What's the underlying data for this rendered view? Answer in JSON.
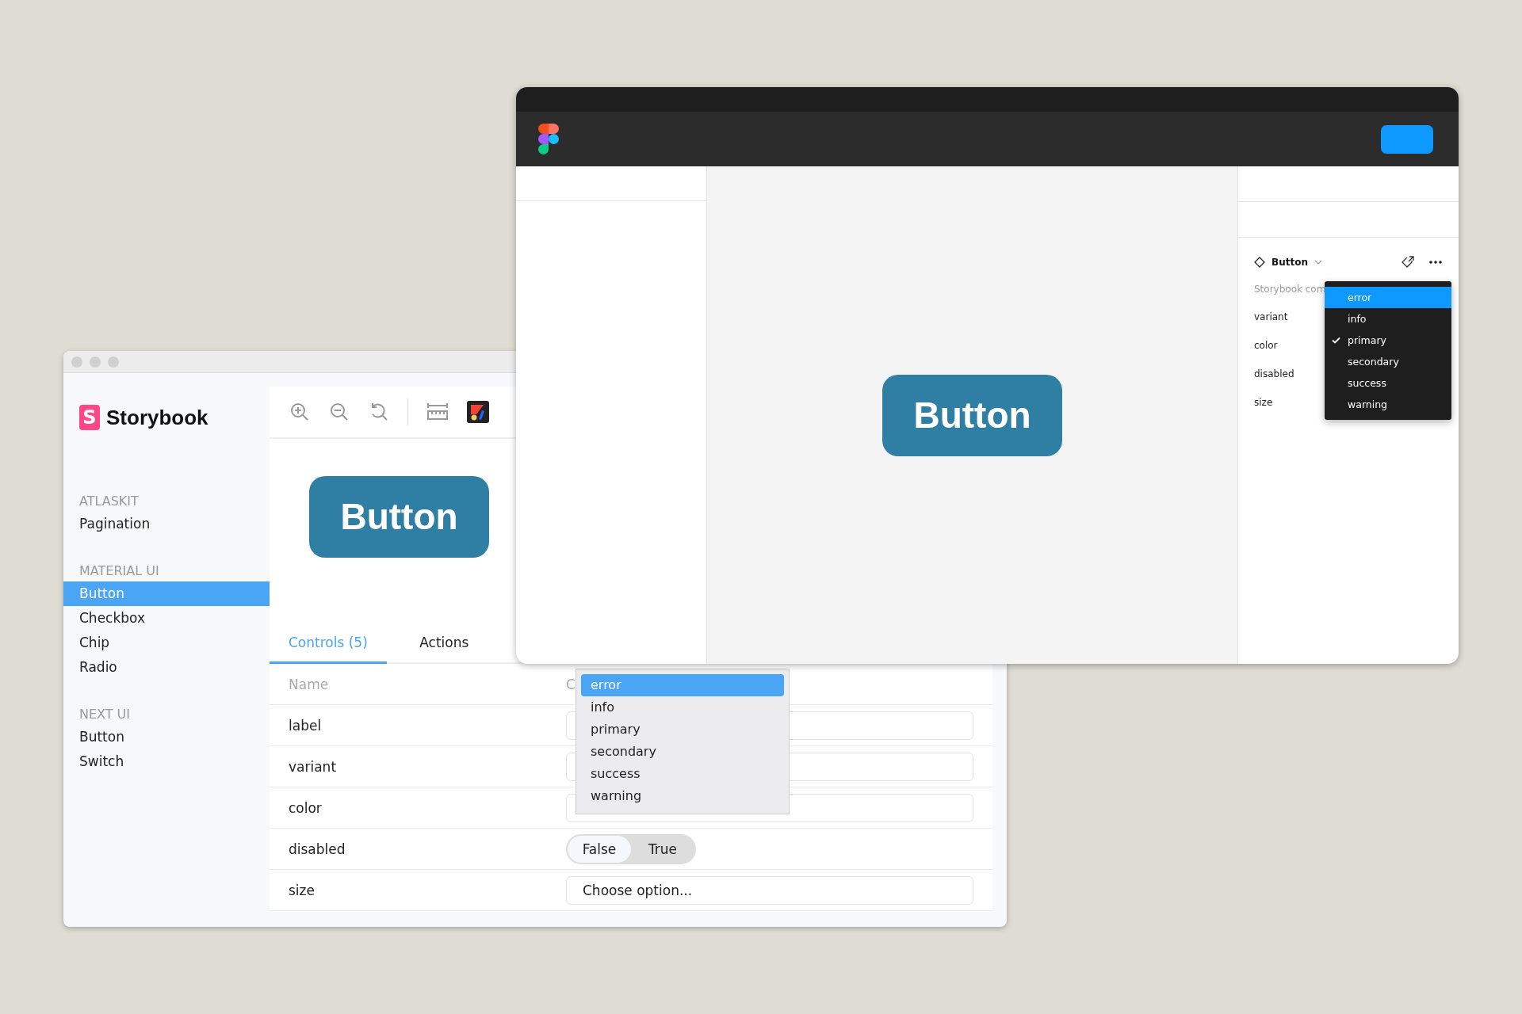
{
  "storybook": {
    "logo_mark": "S",
    "logo": "Storybook",
    "sidebar": [
      {
        "heading": "ATLASKIT",
        "items": [
          {
            "label": "Pagination",
            "selected": false
          }
        ]
      },
      {
        "heading": "MATERIAL UI",
        "items": [
          {
            "label": "Button",
            "selected": true
          },
          {
            "label": "Checkbox",
            "selected": false
          },
          {
            "label": "Chip",
            "selected": false
          },
          {
            "label": "Radio",
            "selected": false
          }
        ]
      },
      {
        "heading": "NEXT UI",
        "items": [
          {
            "label": "Button",
            "selected": false
          },
          {
            "label": "Switch",
            "selected": false
          }
        ]
      }
    ],
    "preview_button": "Button",
    "tabs": [
      {
        "label": "Controls (5)",
        "selected": true
      },
      {
        "label": "Actions",
        "selected": false
      }
    ],
    "table": {
      "columns": [
        "Name",
        "C"
      ],
      "rows": [
        {
          "name": "label",
          "kind": "text"
        },
        {
          "name": "variant",
          "kind": "text"
        },
        {
          "name": "color",
          "kind": "text"
        },
        {
          "name": "disabled",
          "kind": "toggle",
          "options": [
            {
              "label": "False",
              "selected": true
            },
            {
              "label": "True",
              "selected": false
            }
          ]
        },
        {
          "name": "size",
          "kind": "select",
          "value": "Choose option..."
        }
      ]
    },
    "dropdown": [
      {
        "label": "error",
        "selected": true
      },
      {
        "label": "info",
        "selected": false
      },
      {
        "label": "primary",
        "selected": false
      },
      {
        "label": "secondary",
        "selected": false
      },
      {
        "label": "success",
        "selected": false
      },
      {
        "label": "warning",
        "selected": false
      }
    ]
  },
  "figma": {
    "canvas_button": "Button",
    "component": "Button",
    "description": "Storybook com",
    "properties": [
      "variant",
      "color",
      "disabled",
      "size"
    ],
    "dropdown": [
      {
        "label": "error",
        "selected": true,
        "checked": false
      },
      {
        "label": "info",
        "selected": false,
        "checked": false
      },
      {
        "label": "primary",
        "selected": false,
        "checked": true
      },
      {
        "label": "secondary",
        "selected": false,
        "checked": false
      },
      {
        "label": "success",
        "selected": false,
        "checked": false
      },
      {
        "label": "warning",
        "selected": false,
        "checked": false
      }
    ]
  }
}
